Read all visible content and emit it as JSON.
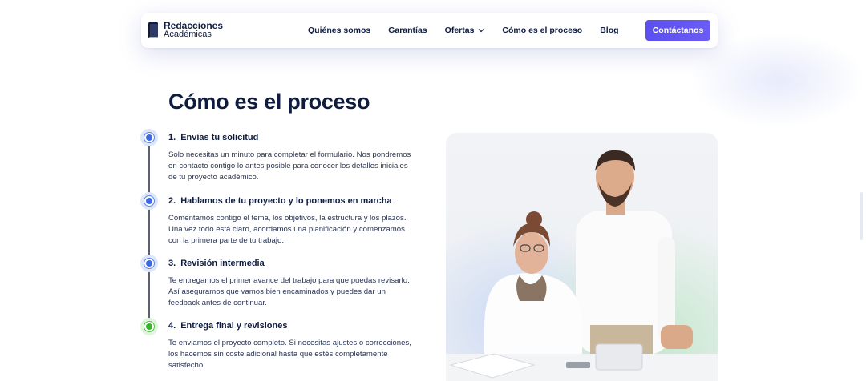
{
  "brand": {
    "line1": "Redacciones",
    "line2": "Académicas"
  },
  "nav": {
    "items": [
      {
        "label": "Quiénes somos"
      },
      {
        "label": "Garantías"
      },
      {
        "label": "Ofertas"
      },
      {
        "label": "Cómo es el proceso"
      },
      {
        "label": "Blog"
      }
    ],
    "cta_label": "Contáctanos"
  },
  "section": {
    "title": "Cómo es el proceso",
    "steps": [
      {
        "number": "1.",
        "title": "Envías tu solicitud",
        "description": "Solo necesitas un minuto para completar el formulario. Nos pondremos en contacto contigo lo antes posible para conocer los detalles iniciales de tu proyecto académico."
      },
      {
        "number": "2.",
        "title": "Hablamos de tu proyecto y lo ponemos en marcha",
        "description": "Comentamos contigo el tema, los objetivos, la estructura y los plazos. Una vez todo está claro, acordamos una planificación y comenzamos con la primera parte de tu trabajo."
      },
      {
        "number": "3.",
        "title": "Revisión intermedia",
        "description": "Te entregamos el primer avance del trabajo para que puedas revisarlo. Así aseguramos que vamos bien encaminados y puedes dar un feedback antes de continuar."
      },
      {
        "number": "4.",
        "title": "Entrega final y revisiones",
        "description": "Te enviamos el proyecto completo. Si necesitas ajustes o correcciones, los hacemos sin coste adicional hasta que estés completamente satisfecho."
      }
    ]
  },
  "colors": {
    "accent": "#5b4ff0",
    "text_dark": "#0f1c3f",
    "timeline_blue": "#3d6ae0",
    "timeline_green": "#36b52a"
  },
  "icons": {
    "logo": "book-icon",
    "dropdown": "chevron-down-icon"
  }
}
